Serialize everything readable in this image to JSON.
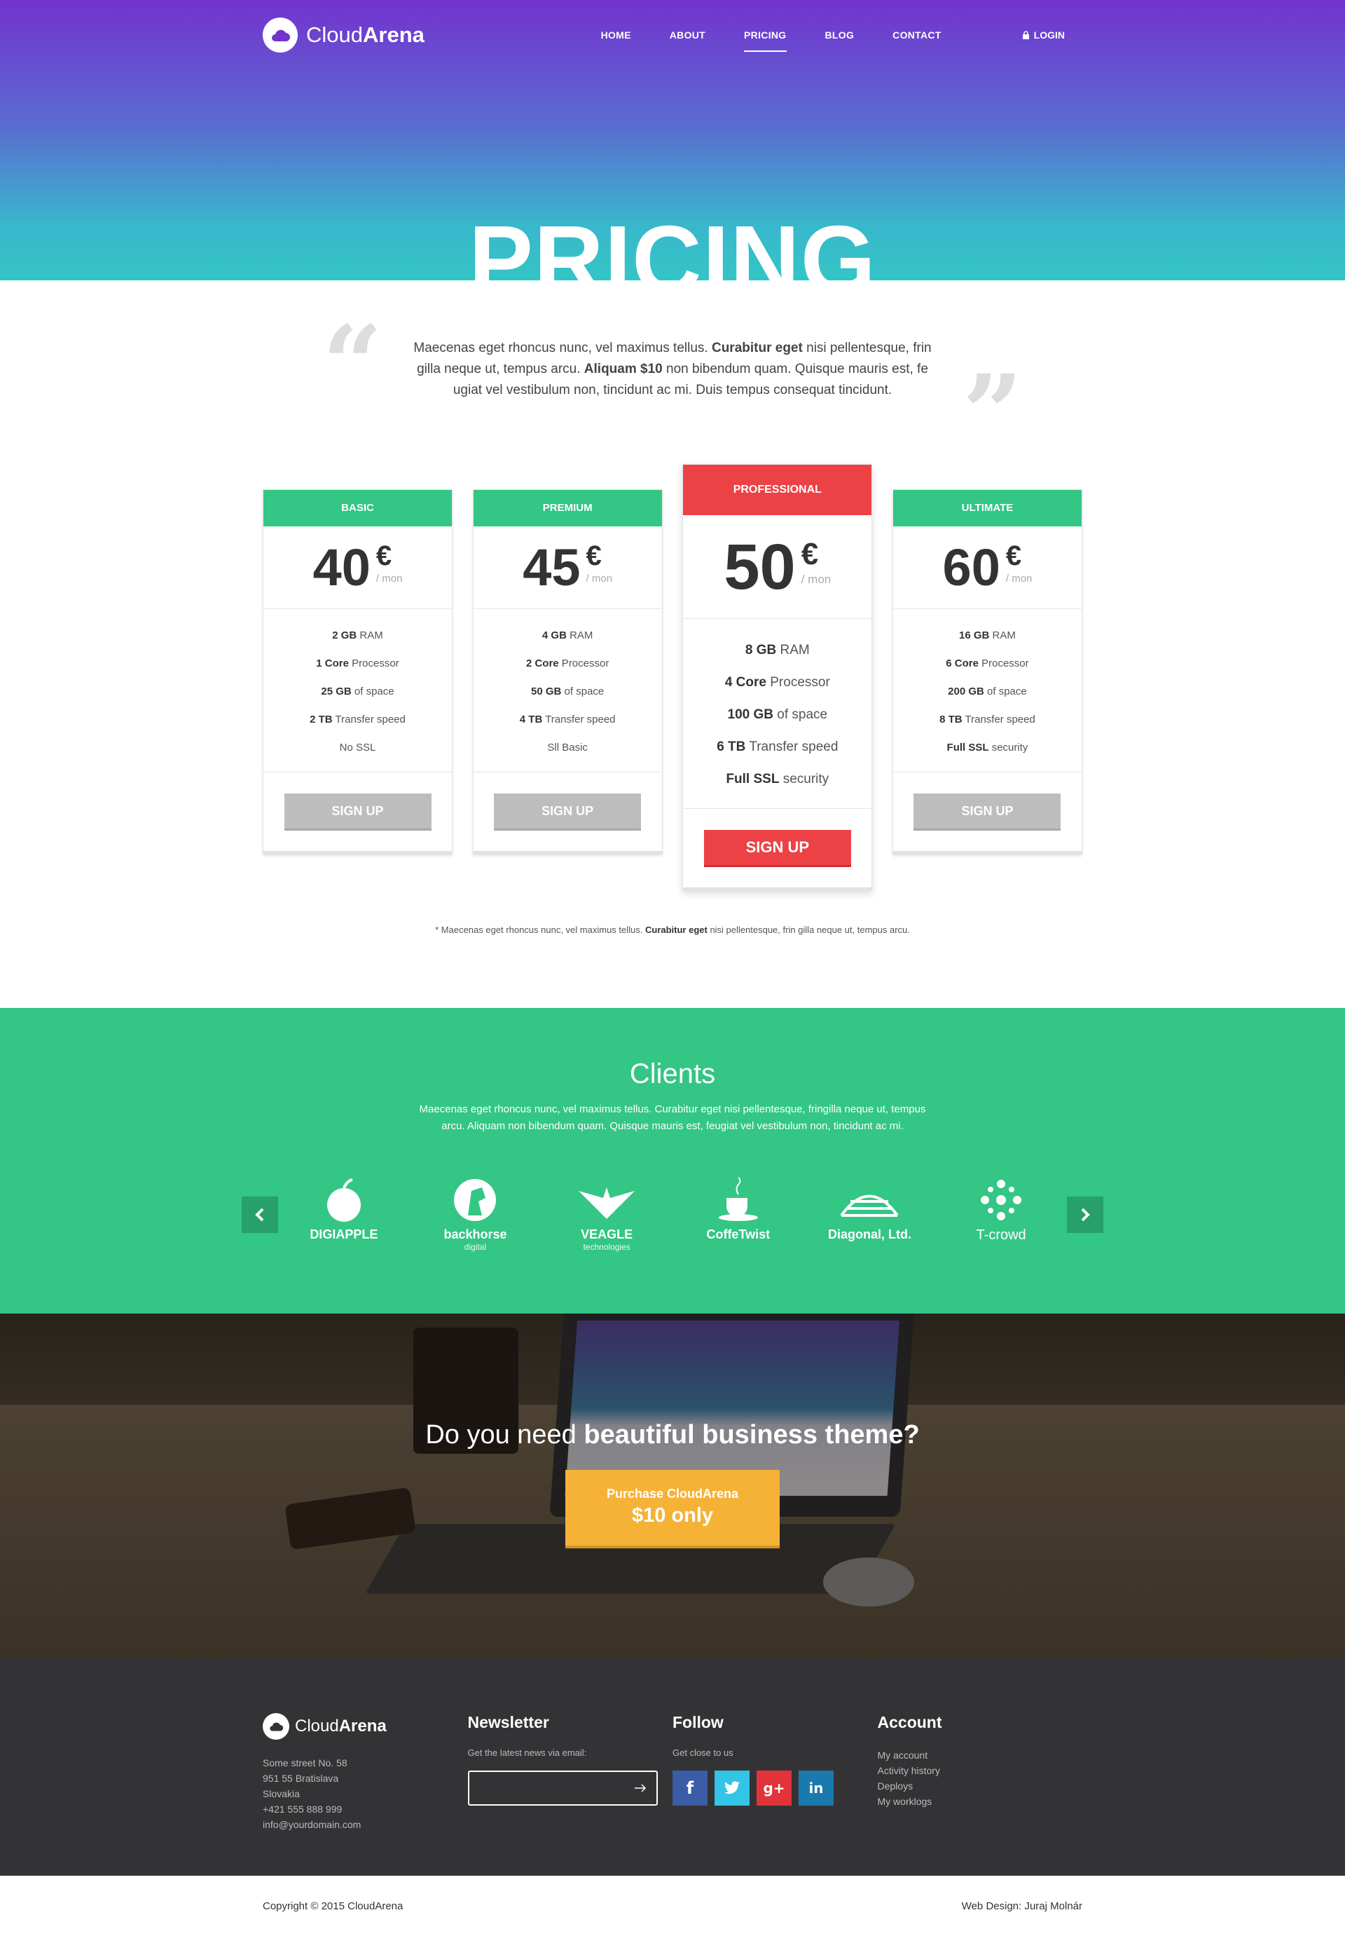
{
  "brand": {
    "name_light": "Cloud",
    "name_bold": "Arena"
  },
  "nav": {
    "items": [
      "HOME",
      "ABOUT",
      "PRICING",
      "BLOG",
      "CONTACT"
    ],
    "active": "PRICING",
    "login": "LOGIN"
  },
  "hero": {
    "title": "PRICING"
  },
  "quote": {
    "part1": "Maecenas eget rhoncus nunc, vel maximus tellus. ",
    "bold1": "Curabitur eget",
    "part2": " nisi pellentesque, frin gilla neque ut, tempus arcu. ",
    "bold2": "Aliquam $10",
    "part3": " non bibendum quam. Quisque mauris est, fe ugiat vel vestibulum non, tincidunt ac mi. Duis tempus consequat tincidunt."
  },
  "plans": [
    {
      "name": "BASIC",
      "price": "40",
      "currency": "€",
      "period": "/ mon",
      "features": [
        [
          "2 GB",
          " RAM"
        ],
        [
          "1 Core",
          " Processor"
        ],
        [
          "25 GB",
          " of space"
        ],
        [
          "2 TB",
          " Transfer speed"
        ],
        [
          "",
          "No SSL"
        ]
      ],
      "button": "SIGN UP"
    },
    {
      "name": "PREMIUM",
      "price": "45",
      "currency": "€",
      "period": "/ mon",
      "features": [
        [
          "4 GB",
          " RAM"
        ],
        [
          "2 Core",
          " Processor"
        ],
        [
          "50 GB",
          " of space"
        ],
        [
          "4 TB",
          " Transfer speed"
        ],
        [
          "",
          "Sll Basic"
        ]
      ],
      "button": "SIGN UP"
    },
    {
      "name": "PROFESSIONAL",
      "price": "50",
      "currency": "€",
      "period": "/ mon",
      "features": [
        [
          "8 GB",
          " RAM"
        ],
        [
          "4 Core",
          " Processor"
        ],
        [
          "100 GB",
          " of space"
        ],
        [
          "6 TB",
          " Transfer speed"
        ],
        [
          "Full SSL",
          " security"
        ]
      ],
      "button": "SIGN UP"
    },
    {
      "name": "ULTIMATE",
      "price": "60",
      "currency": "€",
      "period": "/ mon",
      "features": [
        [
          "16 GB",
          " RAM"
        ],
        [
          "6 Core",
          " Processor"
        ],
        [
          "200 GB",
          " of space"
        ],
        [
          "8 TB",
          " Transfer speed"
        ],
        [
          "Full SSL",
          " security"
        ]
      ],
      "button": "SIGN UP"
    }
  ],
  "pricing_note": {
    "part1": "* Maecenas eget rhoncus nunc, vel maximus tellus. ",
    "bold": "Curabitur eget",
    "part2": " nisi pellentesque, frin gilla neque ut, tempus arcu."
  },
  "clients": {
    "title": "Clients",
    "text": "Maecenas eget rhoncus nunc, vel maximus tellus. Curabitur eget nisi pellentesque, fringilla neque ut, tempus arcu. Aliquam non bibendum quam. Quisque mauris est, feugiat vel vestibulum non, tincidunt ac mi.",
    "logos": [
      {
        "name": "DIGIAPPLE",
        "sub": "",
        "icon": "apple-icon"
      },
      {
        "name": "backhorse",
        "sub": "digital",
        "icon": "horse-icon"
      },
      {
        "name": "VEAGLE",
        "sub": "technologies",
        "icon": "eagle-icon"
      },
      {
        "name": "CoffeTwist",
        "sub": "",
        "icon": "coffee-cup-icon"
      },
      {
        "name": "Diagonal, Ltd.",
        "sub": "",
        "icon": "dome-icon"
      },
      {
        "name": "T-crowd",
        "sub": "",
        "icon": "network-icon"
      }
    ]
  },
  "cta": {
    "title_normal": "Do you need ",
    "title_bold": "beautiful business theme?",
    "button_line1": "Purchase CloudArena",
    "button_line2": "$10 only"
  },
  "footer": {
    "address": [
      "Some street No. 58",
      "951 55 Bratislava",
      "Slovakia",
      "+421 555 888 999",
      "info@yourdomain.com"
    ],
    "newsletter": {
      "title": "Newsletter",
      "text": "Get the latest news via email:",
      "placeholder": ""
    },
    "follow": {
      "title": "Follow",
      "text": "Get close to us",
      "networks": [
        "facebook-icon",
        "twitter-icon",
        "google-plus-icon",
        "linkedin-icon"
      ]
    },
    "account": {
      "title": "Account",
      "links": [
        "My account",
        "Activity history",
        "Deploys",
        "My worklogs"
      ]
    },
    "copyright": "Copyright © 2015 CloudArena",
    "credit": "Web Design: Juraj Molnár"
  },
  "colors": {
    "green": "#33c685",
    "red": "#ec4246",
    "orange": "#f5b236",
    "purple": "#7333cf",
    "teal": "#33c5c5"
  }
}
